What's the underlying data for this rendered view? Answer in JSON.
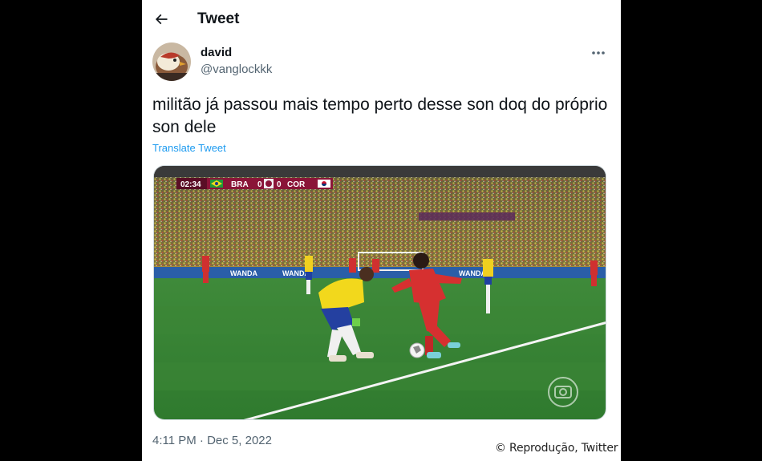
{
  "header": {
    "title": "Tweet",
    "back_icon": "arrow-left-icon"
  },
  "author": {
    "display_name": "david",
    "handle": "@vanglockkk",
    "avatar_icon": "bird-avatar"
  },
  "tweet": {
    "text": "militão já passou mais tempo perto desse son doq do próprio son dele",
    "translate_label": "Translate Tweet",
    "timestamp": "4:11 PM · Dec 5, 2022",
    "more_icon": "more-dots-icon"
  },
  "media": {
    "scoreboard": {
      "time": "02:34",
      "home_team": "BRA",
      "home_score": "0",
      "away_score": "0",
      "away_team": "COR"
    },
    "board_text": "WANDA",
    "broadcaster_icon": "globo-logo"
  },
  "credit": "© Reprodução, Twitter",
  "colors": {
    "link": "#1d9bf0",
    "text": "#0f1419",
    "secondary": "#536471"
  }
}
